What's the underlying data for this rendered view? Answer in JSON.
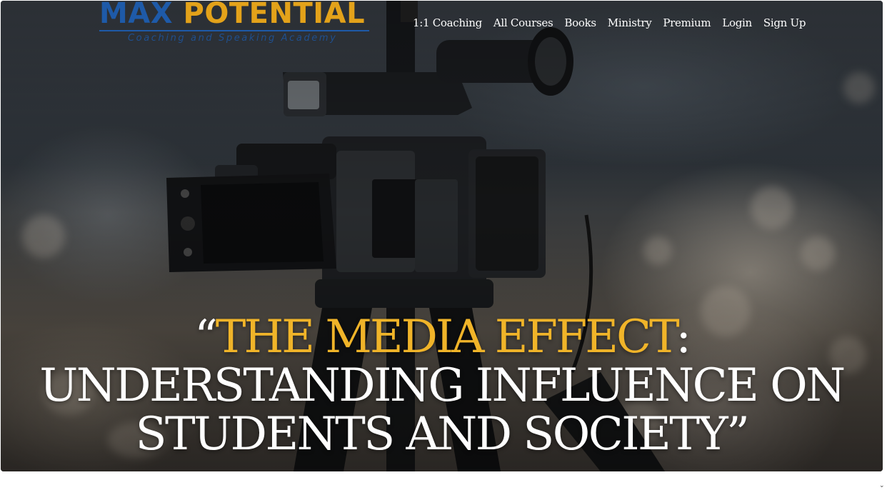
{
  "brand": {
    "name_part1": "MAX",
    "name_part2": "POTENTIAL",
    "tagline": "Coaching and Speaking Academy",
    "colors": {
      "blue": "#1e5aa8",
      "gold": "#e3a21a"
    }
  },
  "nav": {
    "items": [
      {
        "label": "1:1 Coaching"
      },
      {
        "label": "All Courses"
      },
      {
        "label": "Books"
      },
      {
        "label": "Ministry"
      },
      {
        "label": "Premium"
      },
      {
        "label": "Login"
      },
      {
        "label": "Sign Up"
      }
    ]
  },
  "hero": {
    "background_image": "professional video camera in front of blurred audience",
    "headline": {
      "open_quote": "“",
      "highlight": "THE MEDIA EFFECT",
      "colon": ":",
      "line2": "UNDERSTANDING INFLUENCE ON",
      "line3": "STUDENTS AND SOCIETY”"
    },
    "accent_color": "#f0b429"
  },
  "icons": {
    "corner": "chevron-down-icon"
  }
}
